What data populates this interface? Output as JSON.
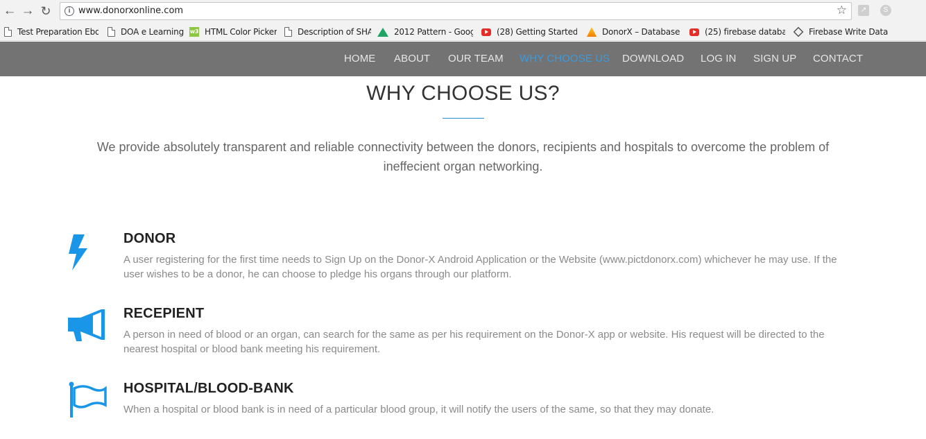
{
  "browser": {
    "url": "www.donorxonline.com",
    "bookmarks": [
      {
        "label": "Test Preparation Ebo",
        "icon": "document-icon"
      },
      {
        "label": "DOA e Learning",
        "icon": "document-icon"
      },
      {
        "label": "HTML Color Picker",
        "icon": "w3schools-icon"
      },
      {
        "label": "Description of SHA",
        "icon": "document-icon"
      },
      {
        "label": "2012 Pattern - Googl",
        "icon": "google-drive-icon"
      },
      {
        "label": "(28) Getting Started w",
        "icon": "youtube-icon"
      },
      {
        "label": "DonorX – Database –",
        "icon": "firebase-icon"
      },
      {
        "label": "(25) firebase databas",
        "icon": "youtube-icon"
      },
      {
        "label": "Firebase Write Data",
        "icon": "diamond-icon"
      }
    ]
  },
  "nav": {
    "items": [
      {
        "label": "HOME",
        "active": false
      },
      {
        "label": "ABOUT",
        "active": false
      },
      {
        "label": "OUR TEAM",
        "active": false
      },
      {
        "label": "WHY CHOOSE US",
        "active": true
      },
      {
        "label": "DOWNLOAD",
        "active": false
      },
      {
        "label": "LOG IN",
        "active": false
      },
      {
        "label": "SIGN UP",
        "active": false
      },
      {
        "label": "CONTACT",
        "active": false
      }
    ],
    "background_color": "#737373",
    "active_color": "#3a9be0"
  },
  "section": {
    "title": "WHY CHOOSE US?",
    "intro": "We provide absolutely transparent and reliable connectivity between the donors, recipients and hospitals to overcome the problem of ineffecient organ networking.",
    "accent_color": "#1e8ed0",
    "features": [
      {
        "icon": "lightning-bolt-icon",
        "title": "DONOR",
        "text": "A user registering for the first time needs to Sign Up on the Donor-X Android Application or the Website (www.pictdonorx.com) whichever he may use. If the user wishes to be a donor, he can choose to pledge his organs through our platform."
      },
      {
        "icon": "megaphone-icon",
        "title": "RECEPIENT",
        "text": "A person in need of blood or an organ, can search for the same as per his requirement on the Donor-X app or website. His request will be directed to the nearest hospital or blood bank meeting his requirement."
      },
      {
        "icon": "flag-icon",
        "title": "HOSPITAL/BLOOD-BANK",
        "text": "When a hospital or blood bank is in need of a particular blood group, it will notify the users of the same, so that they may donate."
      }
    ]
  }
}
